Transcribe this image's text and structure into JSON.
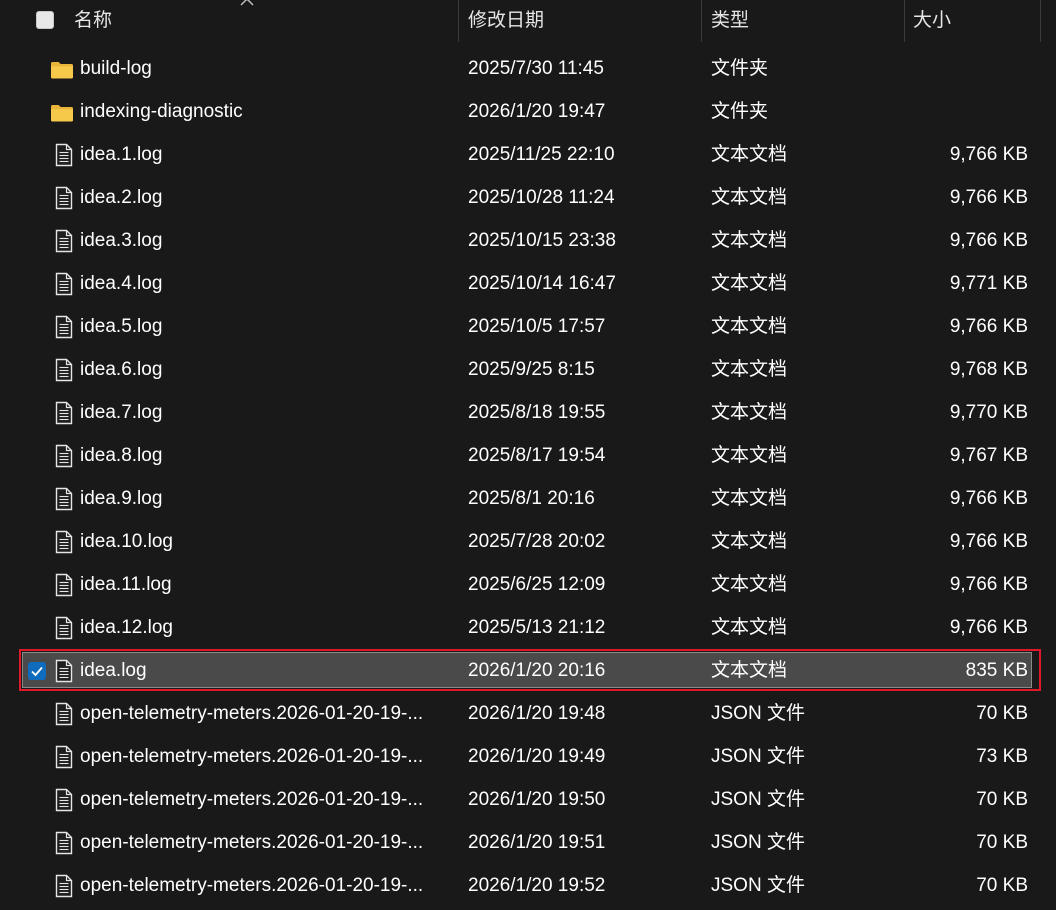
{
  "header": {
    "name_label": "名称",
    "date_label": "修改日期",
    "type_label": "类型",
    "size_label": "大小"
  },
  "files": [
    {
      "name": "build-log",
      "date": "2025/7/30 11:45",
      "type": "文件夹",
      "size": "",
      "kind": "folder"
    },
    {
      "name": "indexing-diagnostic",
      "date": "2026/1/20 19:47",
      "type": "文件夹",
      "size": "",
      "kind": "folder"
    },
    {
      "name": "idea.1.log",
      "date": "2025/11/25 22:10",
      "type": "文本文档",
      "size": "9,766 KB",
      "kind": "file"
    },
    {
      "name": "idea.2.log",
      "date": "2025/10/28 11:24",
      "type": "文本文档",
      "size": "9,766 KB",
      "kind": "file"
    },
    {
      "name": "idea.3.log",
      "date": "2025/10/15 23:38",
      "type": "文本文档",
      "size": "9,766 KB",
      "kind": "file"
    },
    {
      "name": "idea.4.log",
      "date": "2025/10/14 16:47",
      "type": "文本文档",
      "size": "9,771 KB",
      "kind": "file"
    },
    {
      "name": "idea.5.log",
      "date": "2025/10/5 17:57",
      "type": "文本文档",
      "size": "9,766 KB",
      "kind": "file"
    },
    {
      "name": "idea.6.log",
      "date": "2025/9/25 8:15",
      "type": "文本文档",
      "size": "9,768 KB",
      "kind": "file"
    },
    {
      "name": "idea.7.log",
      "date": "2025/8/18 19:55",
      "type": "文本文档",
      "size": "9,770 KB",
      "kind": "file"
    },
    {
      "name": "idea.8.log",
      "date": "2025/8/17 19:54",
      "type": "文本文档",
      "size": "9,767 KB",
      "kind": "file"
    },
    {
      "name": "idea.9.log",
      "date": "2025/8/1 20:16",
      "type": "文本文档",
      "size": "9,766 KB",
      "kind": "file"
    },
    {
      "name": "idea.10.log",
      "date": "2025/7/28 20:02",
      "type": "文本文档",
      "size": "9,766 KB",
      "kind": "file"
    },
    {
      "name": "idea.11.log",
      "date": "2025/6/25 12:09",
      "type": "文本文档",
      "size": "9,766 KB",
      "kind": "file"
    },
    {
      "name": "idea.12.log",
      "date": "2025/5/13 21:12",
      "type": "文本文档",
      "size": "9,766 KB",
      "kind": "file"
    },
    {
      "name": "idea.log",
      "date": "2026/1/20 20:16",
      "type": "文本文档",
      "size": "835 KB",
      "kind": "file",
      "selected": true
    },
    {
      "name": "open-telemetry-meters.2026-01-20-19-...",
      "date": "2026/1/20 19:48",
      "type": "JSON 文件",
      "size": "70 KB",
      "kind": "file"
    },
    {
      "name": "open-telemetry-meters.2026-01-20-19-...",
      "date": "2026/1/20 19:49",
      "type": "JSON 文件",
      "size": "73 KB",
      "kind": "file"
    },
    {
      "name": "open-telemetry-meters.2026-01-20-19-...",
      "date": "2026/1/20 19:50",
      "type": "JSON 文件",
      "size": "70 KB",
      "kind": "file"
    },
    {
      "name": "open-telemetry-meters.2026-01-20-19-...",
      "date": "2026/1/20 19:51",
      "type": "JSON 文件",
      "size": "70 KB",
      "kind": "file"
    },
    {
      "name": "open-telemetry-meters.2026-01-20-19-...",
      "date": "2026/1/20 19:52",
      "type": "JSON 文件",
      "size": "70 KB",
      "kind": "file"
    }
  ],
  "icons": {
    "folder": "folder-icon",
    "file": "document-icon",
    "check": "checkmark-icon",
    "sort": "sort-ascending-icon"
  },
  "colors": {
    "background": "#191919",
    "folder": "#f4c542",
    "selection": "#4a4a4a",
    "highlight_border": "#e0192a",
    "checkbox": "#0f6cbd"
  }
}
